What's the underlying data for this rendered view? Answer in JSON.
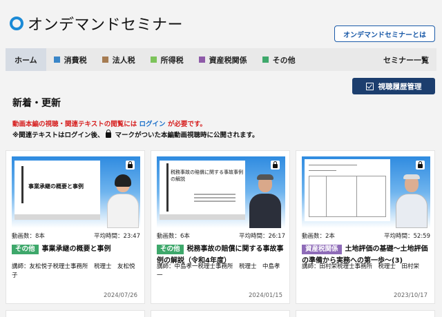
{
  "header": {
    "logo_text": "オンデマンドセミナー",
    "about_button": "オンデマンドセミナーとは"
  },
  "nav": {
    "items": [
      {
        "label": "ホーム",
        "color": ""
      },
      {
        "label": "消費税",
        "color": "#3a86c8"
      },
      {
        "label": "法人税",
        "color": "#a67c52"
      },
      {
        "label": "所得税",
        "color": "#7cc35a"
      },
      {
        "label": "資産税関係",
        "color": "#8e5aa8"
      },
      {
        "label": "その他",
        "color": "#3ea86b"
      }
    ],
    "list_label": "セミナー一覧"
  },
  "history_button": "視聴履歴管理",
  "section_title": "新着・更新",
  "notice": {
    "line1_before": "動画本編の視聴・関連テキストの閲覧には",
    "line1_link": "ログイン",
    "line1_after": "が必要です。",
    "line2_before": "※関連テキストはログイン後、",
    "line2_after": "マークがついた本編動画視聴時に公開されます。"
  },
  "cards": [
    {
      "slide_title": "事業承継の概要と事例",
      "count": "動画数：8本",
      "duration": "平均時間：23:47",
      "tag": "その他",
      "tag_color": "#3ea86b",
      "title": "事業承継の概要と事例",
      "lecturer": "講師：友松悦子税理士事務所　税理士　友松悦子",
      "date": "2024/07/26"
    },
    {
      "slide_title": "税務事故の賠償に関する事故事例の解説",
      "count": "動画数：6本",
      "duration": "平均時間：26:17",
      "tag": "その他",
      "tag_color": "#3ea86b",
      "title": "税務事故の賠償に関する事故事例の解説（令和4年度）",
      "lecturer": "講師：中島孝一税理士事務所　税理士　中島孝一",
      "date": "2024/01/15"
    },
    {
      "slide_title": "",
      "count": "動画数：2本",
      "duration": "平均時間：52:59",
      "tag": "資産税関係",
      "tag_color": "#8e6bb8",
      "title": "土地評価の基礎～土地評価の準備から実務への第一歩～(3)",
      "lecturer": "講師：田村栄税理士事務所　税理士　田村栄",
      "date": "2023/10/17"
    }
  ]
}
